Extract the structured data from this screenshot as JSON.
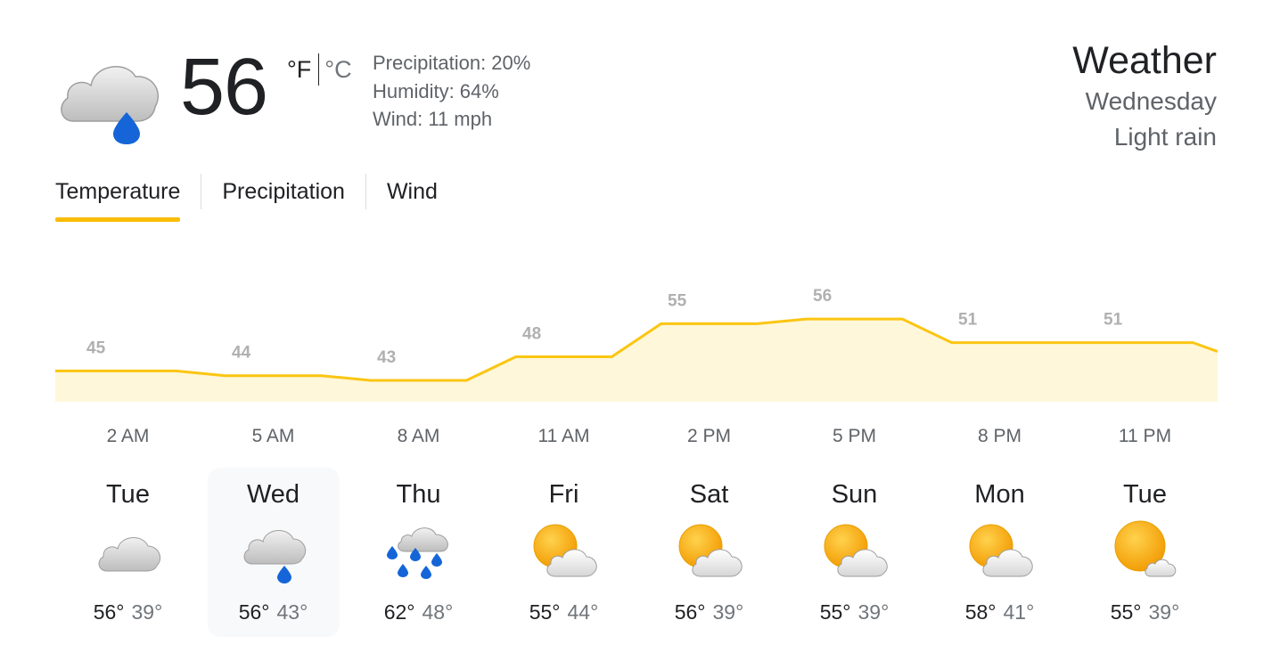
{
  "current": {
    "icon": "cloud-rain-icon",
    "temperature": "56",
    "unit_f": "°F",
    "unit_c": "°C",
    "precipitation": "Precipitation: 20%",
    "humidity": "Humidity: 64%",
    "wind": "Wind: 11 mph"
  },
  "header": {
    "title": "Weather",
    "day": "Wednesday",
    "condition": "Light rain"
  },
  "tabs": [
    {
      "label": "Temperature",
      "active": true
    },
    {
      "label": "Precipitation",
      "active": false
    },
    {
      "label": "Wind",
      "active": false
    }
  ],
  "chart_data": {
    "type": "area",
    "categories": [
      "2 AM",
      "5 AM",
      "8 AM",
      "11 AM",
      "2 PM",
      "5 PM",
      "8 PM",
      "11 PM"
    ],
    "values": [
      45,
      44,
      43,
      48,
      55,
      56,
      51,
      51
    ],
    "fill_color": "#fef7d9",
    "line_color": "#fbc512",
    "label_color": "#b0b0b0"
  },
  "forecast": [
    {
      "day": "Tue",
      "icon": "cloudy-icon",
      "high": "56°",
      "low": "39°",
      "selected": false
    },
    {
      "day": "Wed",
      "icon": "light-rain-icon",
      "high": "56°",
      "low": "43°",
      "selected": true
    },
    {
      "day": "Thu",
      "icon": "rain-icon",
      "high": "62°",
      "low": "48°",
      "selected": false
    },
    {
      "day": "Fri",
      "icon": "partly-cloudy-icon",
      "high": "55°",
      "low": "44°",
      "selected": false
    },
    {
      "day": "Sat",
      "icon": "partly-cloudy-icon",
      "high": "56°",
      "low": "39°",
      "selected": false
    },
    {
      "day": "Sun",
      "icon": "partly-cloudy-icon",
      "high": "55°",
      "low": "39°",
      "selected": false
    },
    {
      "day": "Mon",
      "icon": "partly-cloudy-icon",
      "high": "58°",
      "low": "41°",
      "selected": false
    },
    {
      "day": "Tue",
      "icon": "mostly-sunny-icon",
      "high": "55°",
      "low": "39°",
      "selected": false
    }
  ]
}
